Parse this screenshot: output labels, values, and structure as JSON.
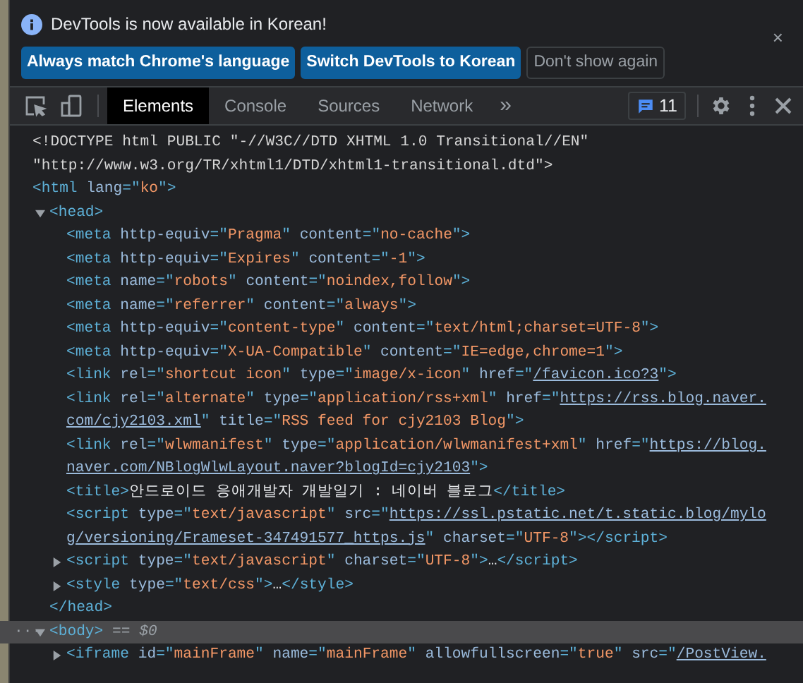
{
  "infobar": {
    "message": "DevTools is now available in Korean!",
    "buttons": [
      {
        "label": "Always match Chrome's language",
        "kind": "primary"
      },
      {
        "label": "Switch DevTools to Korean",
        "kind": "primary"
      },
      {
        "label": "Don't show again",
        "kind": "secondary"
      }
    ],
    "close": "×"
  },
  "toolbar": {
    "tabs": [
      {
        "label": "Elements",
        "selected": true
      },
      {
        "label": "Console",
        "selected": false
      },
      {
        "label": "Sources",
        "selected": false
      },
      {
        "label": "Network",
        "selected": false
      }
    ],
    "more": "»",
    "issues": "11"
  },
  "dom": [
    {
      "lines": [
        [
          {
            "kind": "plain",
            "text": "<!DOCTYPE html PUBLIC \"-//W3C//DTD XHTML 1.0 Transitional//EN\""
          }
        ],
        [
          {
            "kind": "plain",
            "text": "\"http://www.w3.org/TR/xhtml1/DTD/xhtml1-transitional.dtd\">"
          }
        ]
      ]
    },
    {
      "lines": [
        [
          {
            "kind": "tag",
            "text": "<html "
          },
          {
            "kind": "attr",
            "text": "lang"
          },
          {
            "kind": "tag",
            "text": "=\""
          },
          {
            "kind": "val",
            "text": "ko"
          },
          {
            "kind": "tag",
            "text": "\">"
          }
        ]
      ],
      "children": [
        {
          "expanded": true,
          "selected": false,
          "lines": [
            [
              {
                "kind": "tag",
                "text": "<head>"
              }
            ]
          ],
          "close": [
            {
              "kind": "tag",
              "text": "</head>"
            }
          ],
          "children": [
            {
              "lines": [
                [
                  {
                    "kind": "tag",
                    "text": "<meta "
                  },
                  {
                    "kind": "attr",
                    "text": "http-equiv"
                  },
                  {
                    "kind": "tag",
                    "text": "=\""
                  },
                  {
                    "kind": "val",
                    "text": "Pragma"
                  },
                  {
                    "kind": "tag",
                    "text": "\" "
                  },
                  {
                    "kind": "attr",
                    "text": "content"
                  },
                  {
                    "kind": "tag",
                    "text": "=\""
                  },
                  {
                    "kind": "val",
                    "text": "no-cache"
                  },
                  {
                    "kind": "tag",
                    "text": "\">"
                  }
                ]
              ]
            },
            {
              "lines": [
                [
                  {
                    "kind": "tag",
                    "text": "<meta "
                  },
                  {
                    "kind": "attr",
                    "text": "http-equiv"
                  },
                  {
                    "kind": "tag",
                    "text": "=\""
                  },
                  {
                    "kind": "val",
                    "text": "Expires"
                  },
                  {
                    "kind": "tag",
                    "text": "\" "
                  },
                  {
                    "kind": "attr",
                    "text": "content"
                  },
                  {
                    "kind": "tag",
                    "text": "=\""
                  },
                  {
                    "kind": "val",
                    "text": "-1"
                  },
                  {
                    "kind": "tag",
                    "text": "\">"
                  }
                ]
              ]
            },
            {
              "lines": [
                [
                  {
                    "kind": "tag",
                    "text": "<meta "
                  },
                  {
                    "kind": "attr",
                    "text": "name"
                  },
                  {
                    "kind": "tag",
                    "text": "=\""
                  },
                  {
                    "kind": "val",
                    "text": "robots"
                  },
                  {
                    "kind": "tag",
                    "text": "\" "
                  },
                  {
                    "kind": "attr",
                    "text": "content"
                  },
                  {
                    "kind": "tag",
                    "text": "=\""
                  },
                  {
                    "kind": "val",
                    "text": "noindex,follow"
                  },
                  {
                    "kind": "tag",
                    "text": "\">"
                  }
                ]
              ]
            },
            {
              "lines": [
                [
                  {
                    "kind": "tag",
                    "text": "<meta "
                  },
                  {
                    "kind": "attr",
                    "text": "name"
                  },
                  {
                    "kind": "tag",
                    "text": "=\""
                  },
                  {
                    "kind": "val",
                    "text": "referrer"
                  },
                  {
                    "kind": "tag",
                    "text": "\" "
                  },
                  {
                    "kind": "attr",
                    "text": "content"
                  },
                  {
                    "kind": "tag",
                    "text": "=\""
                  },
                  {
                    "kind": "val",
                    "text": "always"
                  },
                  {
                    "kind": "tag",
                    "text": "\">"
                  }
                ]
              ]
            },
            {
              "lines": [
                [
                  {
                    "kind": "tag",
                    "text": "<meta "
                  },
                  {
                    "kind": "attr",
                    "text": "http-equiv"
                  },
                  {
                    "kind": "tag",
                    "text": "=\""
                  },
                  {
                    "kind": "val",
                    "text": "content-type"
                  },
                  {
                    "kind": "tag",
                    "text": "\" "
                  },
                  {
                    "kind": "attr",
                    "text": "content"
                  },
                  {
                    "kind": "tag",
                    "text": "=\""
                  },
                  {
                    "kind": "val",
                    "text": "text/html;charset=UTF-8"
                  },
                  {
                    "kind": "tag",
                    "text": "\">"
                  }
                ]
              ]
            },
            {
              "lines": [
                [
                  {
                    "kind": "tag",
                    "text": "<meta "
                  },
                  {
                    "kind": "attr",
                    "text": "http-equiv"
                  },
                  {
                    "kind": "tag",
                    "text": "=\""
                  },
                  {
                    "kind": "val",
                    "text": "X-UA-Compatible"
                  },
                  {
                    "kind": "tag",
                    "text": "\" "
                  },
                  {
                    "kind": "attr",
                    "text": "content"
                  },
                  {
                    "kind": "tag",
                    "text": "=\""
                  },
                  {
                    "kind": "val",
                    "text": "IE=edge,chrome=1"
                  },
                  {
                    "kind": "tag",
                    "text": "\">"
                  }
                ]
              ]
            },
            {
              "lines": [
                [
                  {
                    "kind": "tag",
                    "text": "<link "
                  },
                  {
                    "kind": "attr",
                    "text": "rel"
                  },
                  {
                    "kind": "tag",
                    "text": "=\""
                  },
                  {
                    "kind": "val",
                    "text": "shortcut icon"
                  },
                  {
                    "kind": "tag",
                    "text": "\" "
                  },
                  {
                    "kind": "attr",
                    "text": "type"
                  },
                  {
                    "kind": "tag",
                    "text": "=\""
                  },
                  {
                    "kind": "val",
                    "text": "image/x-icon"
                  },
                  {
                    "kind": "tag",
                    "text": "\" "
                  },
                  {
                    "kind": "attr",
                    "text": "href"
                  },
                  {
                    "kind": "tag",
                    "text": "=\""
                  },
                  {
                    "kind": "link",
                    "text": "/favicon.ico?3"
                  },
                  {
                    "kind": "tag",
                    "text": "\">"
                  }
                ]
              ]
            },
            {
              "lines": [
                [
                  {
                    "kind": "tag",
                    "text": "<link "
                  },
                  {
                    "kind": "attr",
                    "text": "rel"
                  },
                  {
                    "kind": "tag",
                    "text": "=\""
                  },
                  {
                    "kind": "val",
                    "text": "alternate"
                  },
                  {
                    "kind": "tag",
                    "text": "\" "
                  },
                  {
                    "kind": "attr",
                    "text": "type"
                  },
                  {
                    "kind": "tag",
                    "text": "=\""
                  },
                  {
                    "kind": "val",
                    "text": "application/rss+xml"
                  },
                  {
                    "kind": "tag",
                    "text": "\" "
                  },
                  {
                    "kind": "attr",
                    "text": "href"
                  },
                  {
                    "kind": "tag",
                    "text": "=\""
                  },
                  {
                    "kind": "link",
                    "text": "https://rss.blog.naver."
                  }
                ],
                [
                  {
                    "kind": "link",
                    "text": "com/cjy2103.xml"
                  },
                  {
                    "kind": "tag",
                    "text": "\" "
                  },
                  {
                    "kind": "attr",
                    "text": "title"
                  },
                  {
                    "kind": "tag",
                    "text": "=\""
                  },
                  {
                    "kind": "val",
                    "text": "RSS feed for cjy2103 Blog"
                  },
                  {
                    "kind": "tag",
                    "text": "\">"
                  }
                ]
              ]
            },
            {
              "lines": [
                [
                  {
                    "kind": "tag",
                    "text": "<link "
                  },
                  {
                    "kind": "attr",
                    "text": "rel"
                  },
                  {
                    "kind": "tag",
                    "text": "=\""
                  },
                  {
                    "kind": "val",
                    "text": "wlwmanifest"
                  },
                  {
                    "kind": "tag",
                    "text": "\" "
                  },
                  {
                    "kind": "attr",
                    "text": "type"
                  },
                  {
                    "kind": "tag",
                    "text": "=\""
                  },
                  {
                    "kind": "val",
                    "text": "application/wlwmanifest+xml"
                  },
                  {
                    "kind": "tag",
                    "text": "\" "
                  },
                  {
                    "kind": "attr",
                    "text": "href"
                  },
                  {
                    "kind": "tag",
                    "text": "=\""
                  },
                  {
                    "kind": "link",
                    "text": "https://blog."
                  }
                ],
                [
                  {
                    "kind": "link",
                    "text": "naver.com/NBlogWlwLayout.naver?blogId=cjy2103"
                  },
                  {
                    "kind": "tag",
                    "text": "\">"
                  }
                ]
              ]
            },
            {
              "lines": [
                [
                  {
                    "kind": "tag",
                    "text": "<title>"
                  },
                  {
                    "kind": "text",
                    "text": "안드로이드 응애개발자 개발일기 : 네이버 블로그"
                  },
                  {
                    "kind": "tag",
                    "text": "</title>"
                  }
                ]
              ]
            },
            {
              "lines": [
                [
                  {
                    "kind": "tag",
                    "text": "<script "
                  },
                  {
                    "kind": "attr",
                    "text": "type"
                  },
                  {
                    "kind": "tag",
                    "text": "=\""
                  },
                  {
                    "kind": "val",
                    "text": "text/javascript"
                  },
                  {
                    "kind": "tag",
                    "text": "\" "
                  },
                  {
                    "kind": "attr",
                    "text": "src"
                  },
                  {
                    "kind": "tag",
                    "text": "=\""
                  },
                  {
                    "kind": "link",
                    "text": "https://ssl.pstatic.net/t.static.blog/mylo"
                  }
                ],
                [
                  {
                    "kind": "link",
                    "text": "g/versioning/Frameset-347491577_https.js"
                  },
                  {
                    "kind": "tag",
                    "text": "\" "
                  },
                  {
                    "kind": "attr",
                    "text": "charset"
                  },
                  {
                    "kind": "tag",
                    "text": "=\""
                  },
                  {
                    "kind": "val",
                    "text": "UTF-8"
                  },
                  {
                    "kind": "tag",
                    "text": "\"></script>"
                  }
                ]
              ]
            },
            {
              "expanded": false,
              "selected": false,
              "lines": [
                [
                  {
                    "kind": "tag",
                    "text": "<script "
                  },
                  {
                    "kind": "attr",
                    "text": "type"
                  },
                  {
                    "kind": "tag",
                    "text": "=\""
                  },
                  {
                    "kind": "val",
                    "text": "text/javascript"
                  },
                  {
                    "kind": "tag",
                    "text": "\" "
                  },
                  {
                    "kind": "attr",
                    "text": "charset"
                  },
                  {
                    "kind": "tag",
                    "text": "=\""
                  },
                  {
                    "kind": "val",
                    "text": "UTF-8"
                  },
                  {
                    "kind": "tag",
                    "text": "\">"
                  },
                  {
                    "kind": "text",
                    "text": "…"
                  },
                  {
                    "kind": "tag",
                    "text": "</script>"
                  }
                ]
              ]
            },
            {
              "expanded": false,
              "selected": false,
              "lines": [
                [
                  {
                    "kind": "tag",
                    "text": "<style "
                  },
                  {
                    "kind": "attr",
                    "text": "type"
                  },
                  {
                    "kind": "tag",
                    "text": "=\""
                  },
                  {
                    "kind": "val",
                    "text": "text/css"
                  },
                  {
                    "kind": "tag",
                    "text": "\">"
                  },
                  {
                    "kind": "text",
                    "text": "…"
                  },
                  {
                    "kind": "tag",
                    "text": "</style>"
                  }
                ]
              ]
            }
          ]
        },
        {
          "expanded": true,
          "selected": true,
          "dots": "···",
          "lines": [
            [
              {
                "kind": "tag",
                "text": "<body>"
              },
              {
                "kind": "marker",
                "text": " == $0"
              }
            ]
          ],
          "children": [
            {
              "expanded": false,
              "selected": false,
              "lines": [
                [
                  {
                    "kind": "tag",
                    "text": "<iframe "
                  },
                  {
                    "kind": "attr",
                    "text": "id"
                  },
                  {
                    "kind": "tag",
                    "text": "=\""
                  },
                  {
                    "kind": "val",
                    "text": "mainFrame"
                  },
                  {
                    "kind": "tag",
                    "text": "\" "
                  },
                  {
                    "kind": "attr",
                    "text": "name"
                  },
                  {
                    "kind": "tag",
                    "text": "=\""
                  },
                  {
                    "kind": "val",
                    "text": "mainFrame"
                  },
                  {
                    "kind": "tag",
                    "text": "\" "
                  },
                  {
                    "kind": "attr",
                    "text": "allowfullscreen"
                  },
                  {
                    "kind": "tag",
                    "text": "=\""
                  },
                  {
                    "kind": "val",
                    "text": "true"
                  },
                  {
                    "kind": "tag",
                    "text": "\" "
                  },
                  {
                    "kind": "attr",
                    "text": "src"
                  },
                  {
                    "kind": "tag",
                    "text": "=\""
                  },
                  {
                    "kind": "link",
                    "text": "/PostView."
                  }
                ]
              ]
            }
          ]
        }
      ]
    }
  ]
}
